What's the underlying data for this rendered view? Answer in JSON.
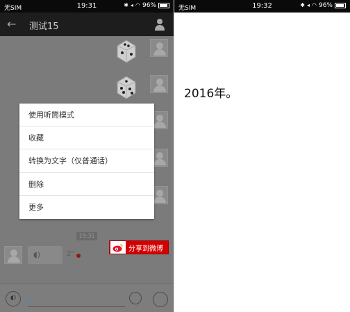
{
  "left": {
    "status": {
      "carrier": "无SIM",
      "time": "19:31",
      "battery": "96%"
    },
    "header": {
      "title": "测试15"
    },
    "chat": {
      "voice_message": {
        "duration": "2\""
      },
      "timestamp": "19:31"
    },
    "context_menu": {
      "items": [
        {
          "label": "使用听筒模式"
        },
        {
          "label": "收藏"
        },
        {
          "label": "转换为文字（仅普通话）"
        },
        {
          "label": "删除"
        },
        {
          "label": "更多"
        }
      ]
    },
    "share": {
      "label": "分享到微博"
    }
  },
  "right": {
    "status": {
      "carrier": "无SIM",
      "time": "19:32",
      "battery": "96%"
    },
    "content": {
      "text": "2016年。"
    }
  },
  "colors": {
    "weibo_red": "#d40000",
    "dim_overlay": "#7b7b7b",
    "unread_dot": "#8b1a1a"
  }
}
